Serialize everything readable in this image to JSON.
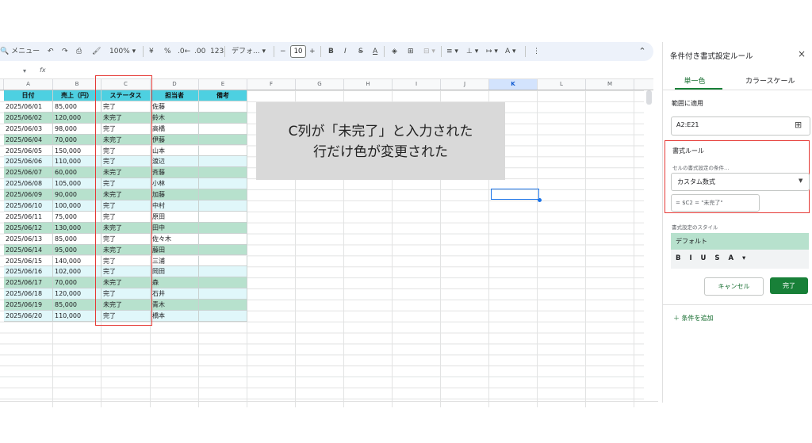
{
  "toolbar": {
    "search_label": "メニュー",
    "zoom": "100%",
    "currency": "¥",
    "percent": "%",
    "dec_decrease": ".0←",
    "dec_increase": ".00",
    "number_format": "123",
    "font_name": "デフォ...",
    "font_size": "10",
    "bold": "B",
    "italic": "I",
    "strike": "S",
    "text_color": "A"
  },
  "formula_bar": {
    "cell_ref": "",
    "fx": "fx"
  },
  "columns": [
    "A",
    "B",
    "C",
    "D",
    "E",
    "F",
    "G",
    "H",
    "I",
    "J",
    "K",
    "L",
    "M"
  ],
  "selected_column": "K",
  "table": {
    "headers": [
      "日付",
      "売上（円）",
      "ステータス",
      "担当者",
      "備考"
    ],
    "rows": [
      [
        "2025/06/01",
        "85,000",
        "完了",
        "佐藤",
        ""
      ],
      [
        "2025/06/02",
        "120,000",
        "未完了",
        "鈴木",
        ""
      ],
      [
        "2025/06/03",
        "98,000",
        "完了",
        "高橋",
        ""
      ],
      [
        "2025/06/04",
        "70,000",
        "未完了",
        "伊藤",
        ""
      ],
      [
        "2025/06/05",
        "150,000",
        "完了",
        "山本",
        ""
      ],
      [
        "2025/06/06",
        "110,000",
        "完了",
        "渡辺",
        ""
      ],
      [
        "2025/06/07",
        "60,000",
        "未完了",
        "斉藤",
        ""
      ],
      [
        "2025/06/08",
        "105,000",
        "完了",
        "小林",
        ""
      ],
      [
        "2025/06/09",
        "90,000",
        "未完了",
        "加藤",
        ""
      ],
      [
        "2025/06/10",
        "100,000",
        "完了",
        "中村",
        ""
      ],
      [
        "2025/06/11",
        "75,000",
        "完了",
        "原田",
        ""
      ],
      [
        "2025/06/12",
        "130,000",
        "未完了",
        "田中",
        ""
      ],
      [
        "2025/06/13",
        "85,000",
        "完了",
        "佐々木",
        ""
      ],
      [
        "2025/06/14",
        "95,000",
        "未完了",
        "藤田",
        ""
      ],
      [
        "2025/06/15",
        "140,000",
        "完了",
        "三浦",
        ""
      ],
      [
        "2025/06/16",
        "102,000",
        "完了",
        "岡田",
        ""
      ],
      [
        "2025/06/17",
        "70,000",
        "未完了",
        "森",
        ""
      ],
      [
        "2025/06/18",
        "120,000",
        "完了",
        "石井",
        ""
      ],
      [
        "2025/06/19",
        "85,000",
        "未完了",
        "青木",
        ""
      ],
      [
        "2025/06/20",
        "110,000",
        "完了",
        "橋本",
        ""
      ]
    ],
    "highlighted_rows": [
      1,
      3,
      6,
      8,
      11,
      13,
      16,
      18
    ],
    "colors": {
      "header": "#4dd0e1",
      "highlight": "#b7e1cd",
      "band": "#e0f7fa",
      "white": "#ffffff"
    }
  },
  "note": {
    "line1": "C列が「未完了」と入力された",
    "line2": "行だけ色が変更された"
  },
  "panel": {
    "title": "条件付き書式設定ルール",
    "close": "×",
    "tab_single": "単一色",
    "tab_scale": "カラースケール",
    "range_label": "範囲に適用",
    "range_value": "A2:E21",
    "rules_label": "書式ルール",
    "condition_label": "セルの書式設定の条件…",
    "condition_value": "カスタム数式",
    "formula": "= $C2 = \"未完了\"",
    "style_label": "書式設定のスタイル",
    "style_default": "デフォルト",
    "style_buttons": "B I U S A ▾",
    "cancel": "キャンセル",
    "done": "完了",
    "add_condition": "＋ 条件を追加"
  }
}
